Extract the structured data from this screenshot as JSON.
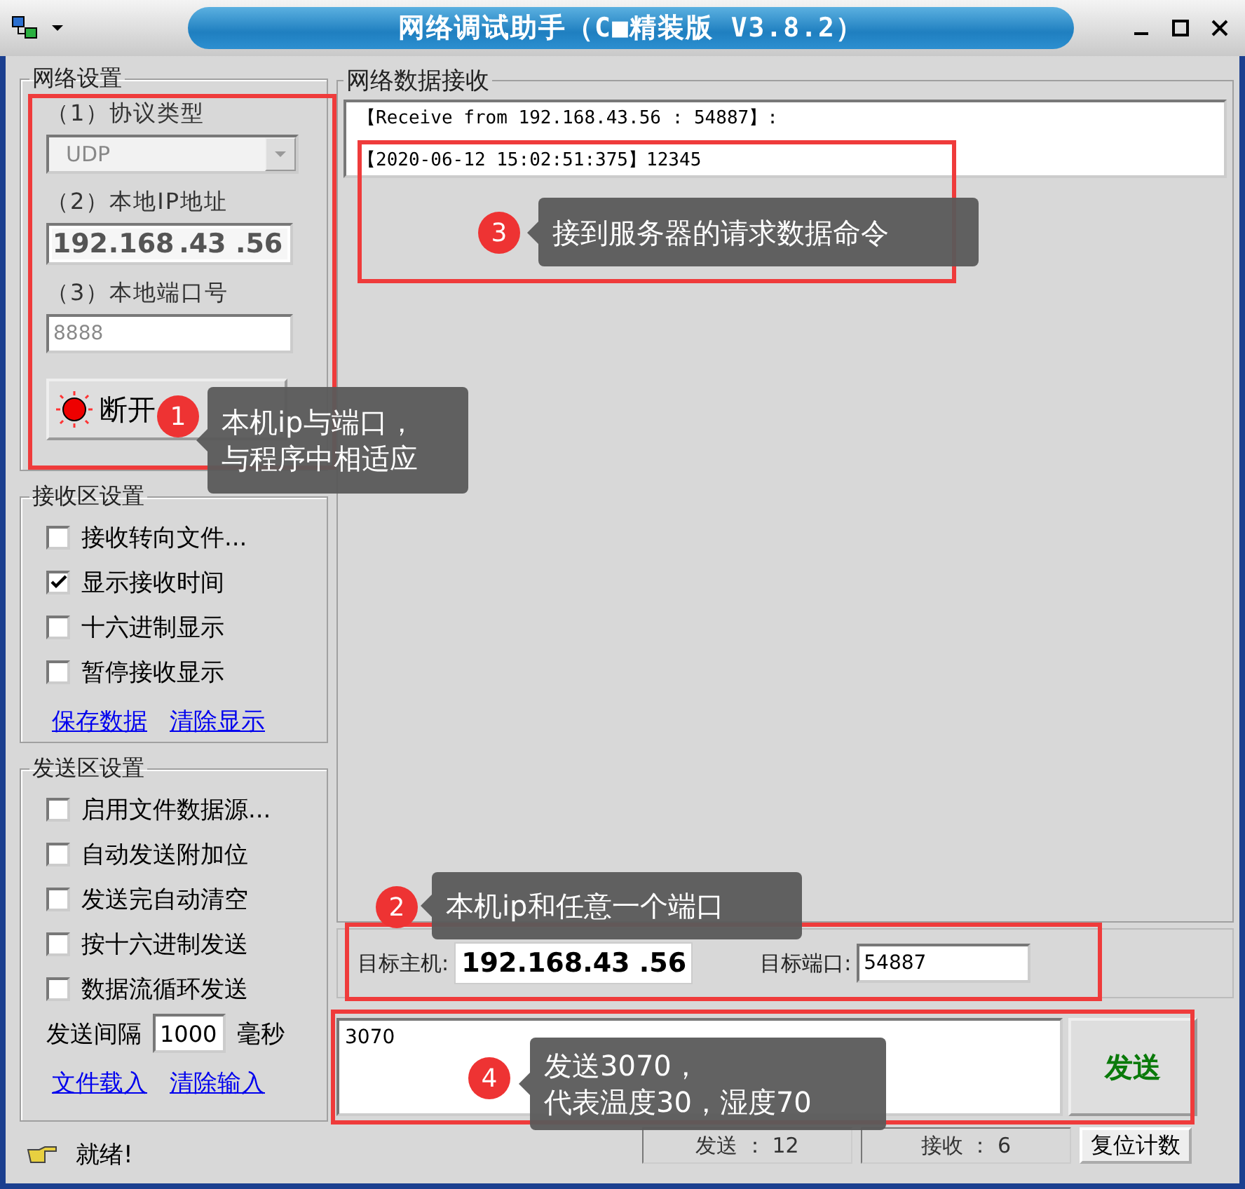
{
  "window": {
    "title": "网络调试助手（C■精装版 V3.8.2）"
  },
  "network_settings": {
    "title": "网络设置",
    "protocol_label": "（1）协议类型",
    "protocol": "UDP",
    "ip_label": "（2）本地IP地址",
    "ip_segments": [
      "192",
      ".168",
      ".43",
      ".56"
    ],
    "port_label": "（3）本地端口号",
    "port": "8888",
    "connect_button": "断开",
    "connected": true
  },
  "receive_settings": {
    "title": "接收区设置",
    "options": [
      {
        "label": "接收转向文件...",
        "checked": false
      },
      {
        "label": "显示接收时间",
        "checked": true
      },
      {
        "label": "十六进制显示",
        "checked": false
      },
      {
        "label": "暂停接收显示",
        "checked": false
      }
    ],
    "links": [
      "保存数据",
      "清除显示"
    ]
  },
  "send_settings": {
    "title": "发送区设置",
    "options": [
      {
        "label": "启用文件数据源...",
        "checked": false
      },
      {
        "label": "自动发送附加位",
        "checked": false
      },
      {
        "label": "发送完自动清空",
        "checked": false
      },
      {
        "label": "按十六进制发送",
        "checked": false
      },
      {
        "label": "数据流循环发送",
        "checked": false
      }
    ],
    "interval_label": "发送间隔",
    "interval": "1000",
    "interval_unit": "毫秒",
    "links": [
      "文件载入",
      "清除输入"
    ]
  },
  "status": "就绪!",
  "receive_area": {
    "title": "网络数据接收",
    "lines": [
      "【Receive from 192.168.43.56 : 54887】:",
      "【2020-06-12 15:02:51:375】12345"
    ]
  },
  "target": {
    "host_label": "目标主机:",
    "host": "192.168.43 .56",
    "port_label": "目标端口:",
    "port": "54887"
  },
  "send_area": {
    "value": "3070",
    "button": "发送"
  },
  "counters": {
    "sent": "发送 ： 12",
    "received": "接收 ： 6",
    "reset_button": "复位计数"
  },
  "annotations": [
    {
      "number": "1",
      "lines": [
        "本机ip与端口，",
        "与程序中相适应"
      ]
    },
    {
      "number": "2",
      "lines": [
        "本机ip和任意一个端口"
      ]
    },
    {
      "number": "3",
      "lines": [
        "接到服务器的请求数据命令"
      ]
    },
    {
      "number": "4",
      "lines": [
        "发送3070，",
        "代表温度30，湿度70"
      ]
    }
  ]
}
